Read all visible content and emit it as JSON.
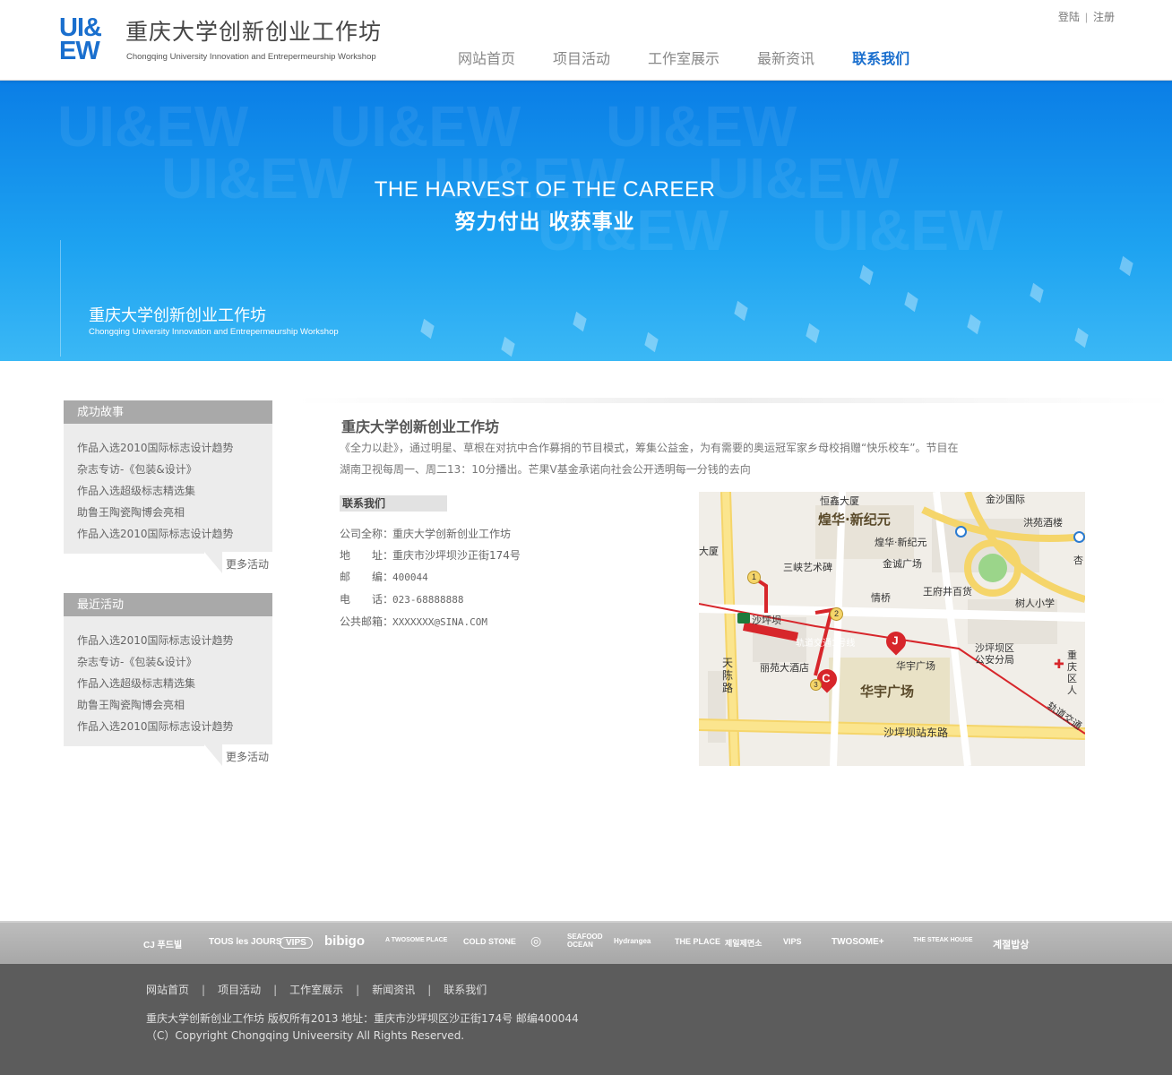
{
  "header": {
    "logo_mark_line1": "UI&",
    "logo_mark_line2": "EW",
    "logo_cn": "重庆大学创新创业工作坊",
    "logo_en": "Chongqing University Innovation and Entrepermeurship Workshop",
    "login": "登陆",
    "register": "注册",
    "nav": [
      "网站首页",
      "项目活动",
      "工作室展示",
      "最新资讯",
      "联系我们"
    ],
    "active_nav": "联系我们"
  },
  "banner": {
    "watermark": "UI&EW",
    "title_en": "THE HARVEST OF THE CAREER",
    "title_cn": "努力付出 收获事业",
    "sub_cn": "重庆大学创新创业工作坊",
    "sub_en": "Chongqing University Innovation and Entrepermeurship Workshop"
  },
  "sidebar": {
    "success": {
      "title": "成功故事",
      "items": [
        "作品入选2010国际标志设计趋势",
        "杂志专访-《包装&设计》",
        "作品入选超级标志精选集",
        "助鲁王陶瓷陶博会亮相",
        "作品入选2010国际标志设计趋势"
      ],
      "more": "更多活动"
    },
    "recent": {
      "title": "最近活动",
      "items": [
        "作品入选2010国际标志设计趋势",
        "杂志专访-《包装&设计》",
        "作品入选超级标志精选集",
        "助鲁王陶瓷陶博会亮相",
        "作品入选2010国际标志设计趋势"
      ],
      "more": "更多活动"
    }
  },
  "main": {
    "title": "重庆大学创新创业工作坊",
    "desc_line1": "《全力以赴》，通过明星、草根在对抗中合作募捐的节目模式，筹集公益金，为有需要的奥运冠军家乡母校捐赠“快乐校车”。节目在",
    "desc_line2": "湖南卫视每周一、周二13：10分播出。芒果V基金承诺向社会公开透明每一分钱的去向",
    "contact_title": "联系我们",
    "contact": [
      {
        "key": "公司全称：",
        "value": "重庆大学创新创业工作坊"
      },
      {
        "key": "地　　址：",
        "value": "重庆市沙坪坝沙正街174号"
      },
      {
        "key": "邮　　编：",
        "value": "400044"
      },
      {
        "key": "电　　话：",
        "value": "023-68888888"
      },
      {
        "key": "公共邮箱：",
        "value": "XXXXXXX@SINA.COM"
      }
    ]
  },
  "map": {
    "labels": [
      "煌华·新纪元",
      "恒鑫大厦",
      "金沙国际",
      "洪苑酒楼",
      "大厦",
      "煌华·新纪元",
      "金诚广场",
      "三峡艺术碑",
      "王府井百货",
      "树人小学",
      "情桥",
      "沙坪坝",
      "轨道交通1号线",
      "丽苑大酒店",
      "华宇广场",
      "华宇广场",
      "沙坪坝区公安分局",
      "重庆区人",
      "天陈路",
      "沙坪坝站东路",
      "轨道交通",
      "杏"
    ],
    "pins": [
      "J",
      "C"
    ],
    "stops": [
      "1",
      "2",
      "3"
    ]
  },
  "footer": {
    "brands": [
      "CJ 푸드빌",
      "TOUS les JOURS",
      "VIPS",
      "bibigo",
      "A TWOSOME PLACE",
      "COLD STONE",
      "◎",
      "SEAFOOD OCEAN",
      "Hydrangea",
      "THE PLACE",
      "제일제면소",
      "VIPS",
      "TWOSOME+",
      "THE STEAK HOUSE",
      "계절밥상"
    ],
    "nav": [
      "网站首页",
      "项目活动",
      "工作室展示",
      "新闻资讯",
      "联系我们"
    ],
    "copyright": "重庆大学创新创业工作坊 版权所有2013  地址：重庆市沙坪坝区沙正街174号  邮编400044",
    "copyright_en": "（C）Copyright Chongqing Univeersity All Rights Reserved."
  }
}
